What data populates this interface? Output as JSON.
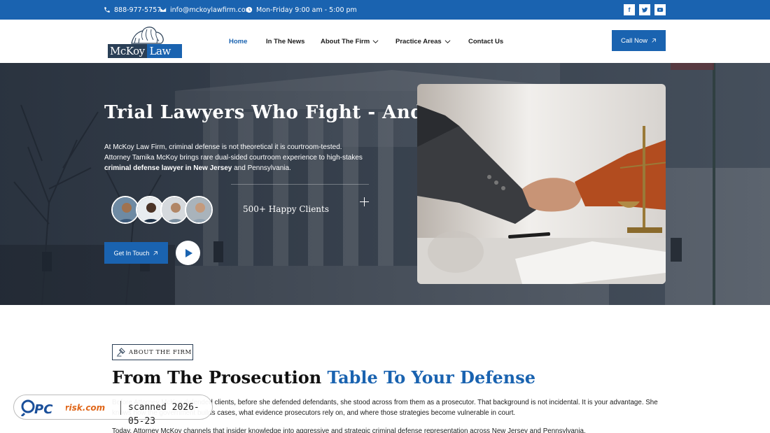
{
  "topbar": {
    "phone": "888-977-5757",
    "email": "info@mckoylawfirm.com",
    "hours": "Mon-Friday 9:00 am - 5:00 pm",
    "social": [
      {
        "icon": "facebook-icon",
        "glyph": "f"
      },
      {
        "icon": "twitter-icon",
        "glyph": "t"
      },
      {
        "icon": "youtube-icon",
        "glyph": "▶"
      }
    ]
  },
  "header": {
    "logo_text_a": "McKoy",
    "logo_text_b": "Law",
    "nav": [
      {
        "label": "Home",
        "active": true
      },
      {
        "label": "In The News"
      },
      {
        "label": "About The Firm",
        "dropdown": true
      },
      {
        "label": "Practice Areas",
        "dropdown": true
      },
      {
        "label": "Contact Us"
      }
    ],
    "cta": "Call Now"
  },
  "hero": {
    "title": "Trial Lawyers Who Fight - And Win",
    "desc_1": "At McKoy Law Firm, criminal defense is not theoretical it is courtroom-tested. Attorney Tamika McKoy brings rare dual-sided courtroom experience to high-stakes ",
    "desc_bold": "criminal defense lawyer in New Jersey",
    "desc_2": " and Pennsylvania.",
    "clients": "500+ Happy Clients",
    "button": "Get In Touch"
  },
  "about": {
    "badge": "ABOUT THE FIRM",
    "title_a": "From The Prosecution ",
    "title_b": "Table To Your Defense",
    "para_1": "Before Attorney McKoy defended clients, before she defended defendants, she stood across from them as a prosecutor. That background is not incidental. It is your advantage. She knows how the government builds cases, what evidence prosecutors rely on, and where those strategies become vulnerable in court.",
    "para_2": "Today, Attorney McKoy channels that insider knowledge into aggressive and strategic criminal defense representation across New Jersey and Pennsylvania."
  },
  "watermark": {
    "brand": "PCrisk.com",
    "scan": "scanned 2026-05-23"
  },
  "colors": {
    "brand_blue": "#1a63b0",
    "navy": "#2a3f56"
  }
}
